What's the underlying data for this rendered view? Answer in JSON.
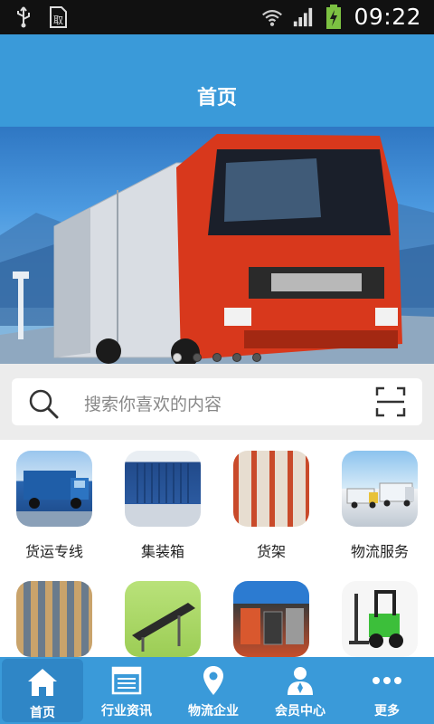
{
  "status_bar": {
    "time": "09:22",
    "left_icons": [
      "usb-icon",
      "sim-icon"
    ],
    "right_icons": [
      "wifi-icon",
      "signal-icon",
      "battery-charging-icon"
    ],
    "battery_color": "#7cc142"
  },
  "header": {
    "title": "首页",
    "background": "#3a9ad9"
  },
  "banner": {
    "image": "volvo-truck-photo",
    "slide_count": 5,
    "active_slide": 1
  },
  "search": {
    "placeholder": "搜索你喜欢的内容",
    "icon": "search-icon",
    "scan_icon": "scan-icon"
  },
  "categories": [
    {
      "label": "货运专线",
      "icon": "freight-truck-thumbnail"
    },
    {
      "label": "集装箱",
      "icon": "container-thumbnail"
    },
    {
      "label": "货架",
      "icon": "shelf-thumbnail"
    },
    {
      "label": "物流服务",
      "icon": "logistics-trucks-thumbnail"
    },
    {
      "label": "",
      "icon": "warehouse-thumbnail"
    },
    {
      "label": "",
      "icon": "conveyor-thumbnail"
    },
    {
      "label": "",
      "icon": "forklift-parts-thumbnail"
    },
    {
      "label": "",
      "icon": "forklift-thumbnail"
    }
  ],
  "bottom_nav": [
    {
      "label": "首页",
      "icon": "home-icon",
      "active": true
    },
    {
      "label": "行业资讯",
      "icon": "news-icon",
      "active": false
    },
    {
      "label": "物流企业",
      "icon": "location-pin-icon",
      "active": false
    },
    {
      "label": "会员中心",
      "icon": "member-icon",
      "active": false
    },
    {
      "label": "更多",
      "icon": "more-icon",
      "active": false
    }
  ]
}
